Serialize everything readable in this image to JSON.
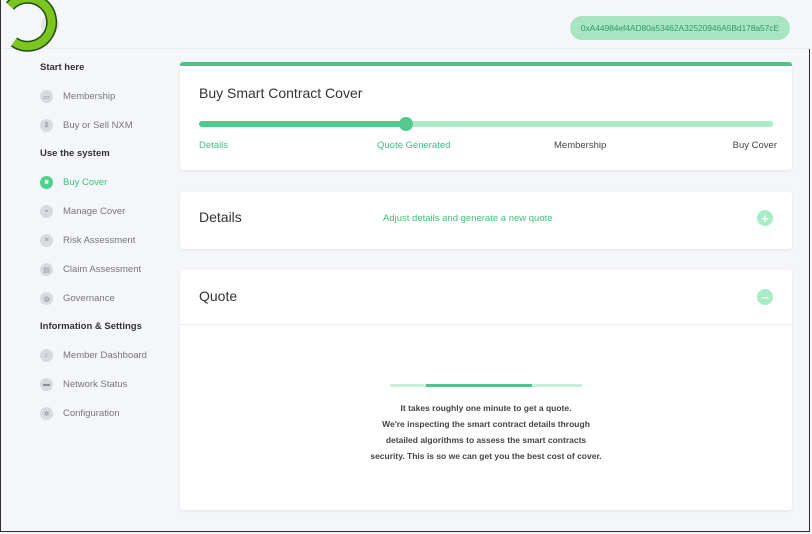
{
  "header": {
    "account_address": "0xA44984ef4AD80a53462A32520946A5Bd178a57cE"
  },
  "colors": {
    "accent": "#52c98e",
    "accent_light": "#a8ecc6",
    "logo": "#7cc521"
  },
  "sidebar": {
    "sections": [
      {
        "title": "Start here",
        "items": [
          {
            "label": "Membership",
            "icon": "membership-icon"
          },
          {
            "label": "Buy or Sell NXM",
            "icon": "dollar-icon"
          }
        ]
      },
      {
        "title": "Use the system",
        "items": [
          {
            "label": "Buy Cover",
            "icon": "lock-icon",
            "active": true
          },
          {
            "label": "Manage Cover",
            "icon": "briefcase-icon"
          },
          {
            "label": "Risk Assessment",
            "icon": "bank-icon"
          },
          {
            "label": "Claim Assessment",
            "icon": "archive-icon"
          },
          {
            "label": "Governance",
            "icon": "globe-icon"
          }
        ]
      },
      {
        "title": "Information & Settings",
        "items": [
          {
            "label": "Member Dashboard",
            "icon": "home-icon"
          },
          {
            "label": "Network Status",
            "icon": "monitor-icon"
          },
          {
            "label": "Configuration",
            "icon": "gear-icon"
          }
        ]
      }
    ]
  },
  "progress_card": {
    "title": "Buy Smart Contract Cover",
    "progress": 0.36,
    "steps": [
      "Details",
      "Quote Generated",
      "Membership",
      "Buy Cover"
    ],
    "completed_steps": 2
  },
  "details_card": {
    "title": "Details",
    "link": "Adjust details and generate a new quote",
    "toggle_icon": "plus-icon"
  },
  "quote_card": {
    "title": "Quote",
    "toggle_icon": "minus-icon",
    "message_lines": [
      "It takes roughly one minute to get a quote.",
      "We're inspecting the smart contract details through",
      "detailed algorithms to assess the smart contracts",
      "security. This is so we can get you the best cost of cover."
    ]
  }
}
